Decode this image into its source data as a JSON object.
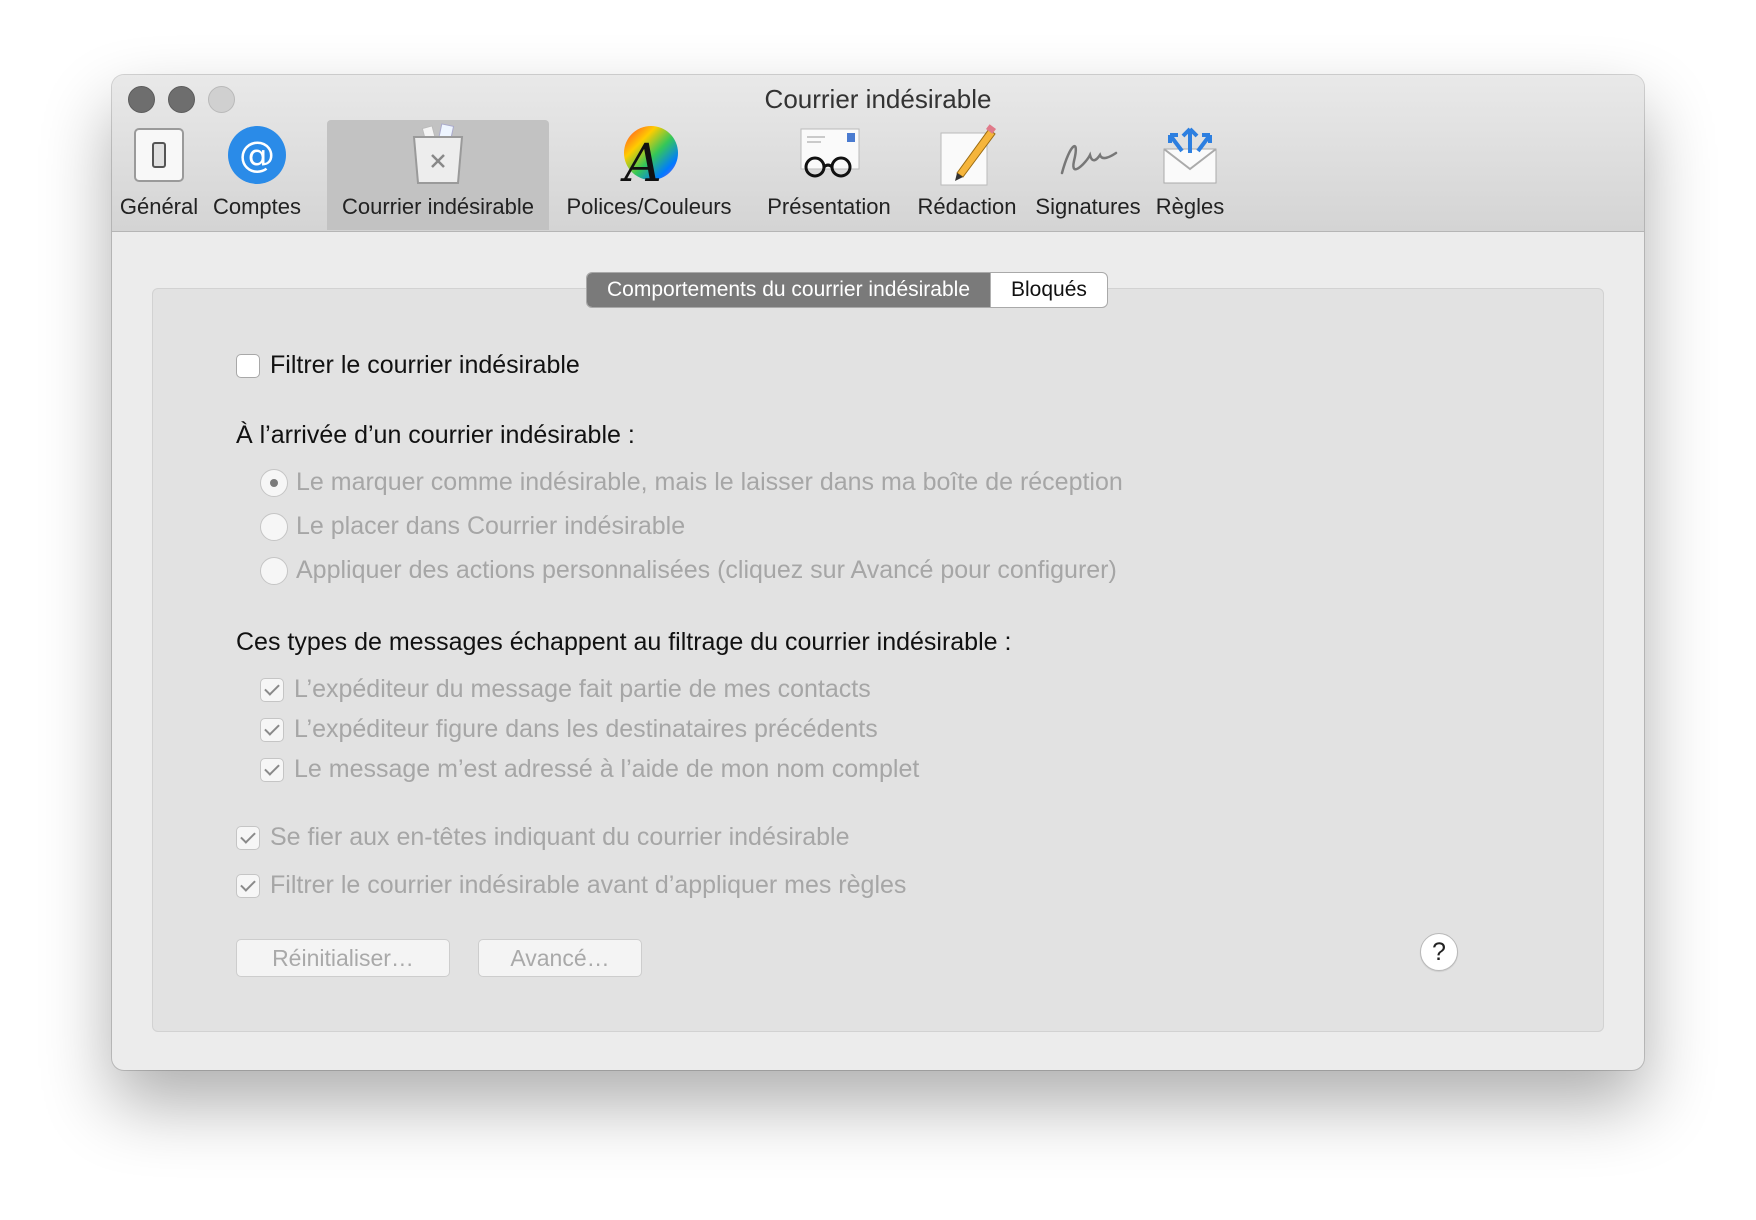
{
  "window": {
    "title": "Courrier indésirable"
  },
  "toolbar": {
    "items": [
      {
        "label": "Général",
        "icon": "switch-icon"
      },
      {
        "label": "Comptes",
        "icon": "at-sign-icon"
      },
      {
        "label": "Courrier indésirable",
        "icon": "junk-bin-icon",
        "selected": true
      },
      {
        "label": "Polices/Couleurs",
        "icon": "fonts-colors-icon"
      },
      {
        "label": "Présentation",
        "icon": "glasses-icon"
      },
      {
        "label": "Rédaction",
        "icon": "pencil-icon"
      },
      {
        "label": "Signatures",
        "icon": "signature-icon"
      },
      {
        "label": "Règles",
        "icon": "rules-envelope-icon"
      }
    ]
  },
  "tabs": {
    "behaviors": "Comportements du courrier indésirable",
    "blocked": "Bloqués",
    "active": "behaviors"
  },
  "filter_junk": {
    "label": "Filtrer le courrier indésirable",
    "checked": false
  },
  "arrival": {
    "heading": "À l’arrivée d’un courrier indésirable :",
    "options": [
      {
        "label": "Le marquer comme indésirable, mais le laisser dans ma boîte de réception",
        "selected": true
      },
      {
        "label": "Le placer dans Courrier indésirable",
        "selected": false
      },
      {
        "label": "Appliquer des actions personnalisées (cliquez sur Avancé pour configurer)",
        "selected": false
      }
    ]
  },
  "exempt": {
    "heading": "Ces types de messages échappent au filtrage du courrier indésirable :",
    "options": [
      {
        "label": "L’expéditeur du message fait partie de mes contacts",
        "checked": true
      },
      {
        "label": "L’expéditeur figure dans les destinataires précédents",
        "checked": true
      },
      {
        "label": "Le message m’est adressé à l’aide de mon nom complet",
        "checked": true
      }
    ]
  },
  "trust_headers": {
    "label": "Se fier aux en-têtes indiquant du courrier indésirable",
    "checked": true
  },
  "filter_before_rules": {
    "label": "Filtrer le courrier indésirable avant d’appliquer mes règles",
    "checked": true
  },
  "buttons": {
    "reset": "Réinitialiser…",
    "advanced": "Avancé…",
    "help": "?"
  },
  "colors": {
    "at_icon_blue": "#2a8be8",
    "selected_tab": "#7a7a7a",
    "disabled_text": "#a6a6a6"
  }
}
